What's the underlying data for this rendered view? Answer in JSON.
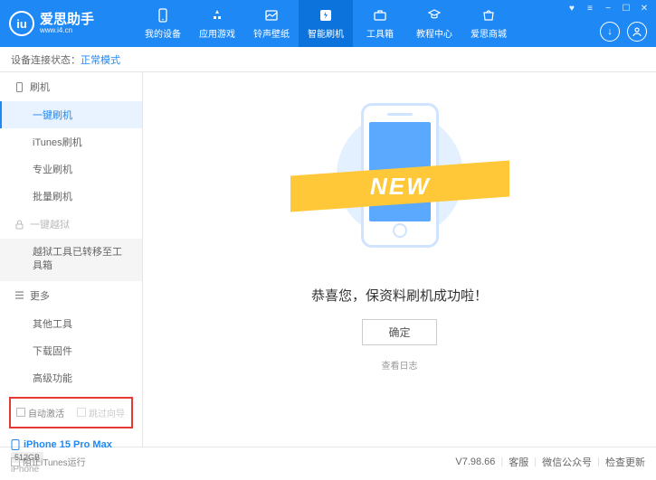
{
  "header": {
    "logo_letter": "iu",
    "app_name": "爱思助手",
    "app_url": "www.i4.cn",
    "nav": [
      {
        "label": "我的设备"
      },
      {
        "label": "应用游戏"
      },
      {
        "label": "铃声壁纸"
      },
      {
        "label": "智能刷机"
      },
      {
        "label": "工具箱"
      },
      {
        "label": "教程中心"
      },
      {
        "label": "爱思商城"
      }
    ]
  },
  "status": {
    "label": "设备连接状态：",
    "value": "正常模式"
  },
  "sidebar": {
    "flash_section": "刷机",
    "items_flash": [
      "一键刷机",
      "iTunes刷机",
      "专业刷机",
      "批量刷机"
    ],
    "jailbreak_section": "一键越狱",
    "jailbreak_note": "越狱工具已转移至工具箱",
    "more_section": "更多",
    "items_more": [
      "其他工具",
      "下载固件",
      "高级功能"
    ],
    "checkboxes": {
      "auto_activate": "自动激活",
      "skip_guide": "跳过向导"
    },
    "device": {
      "name": "iPhone 15 Pro Max",
      "storage": "512GB",
      "type": "iPhone"
    }
  },
  "main": {
    "ribbon": "NEW",
    "success": "恭喜您，保资料刷机成功啦！",
    "ok": "确定",
    "log": "查看日志"
  },
  "footer": {
    "block_itunes": "阻止iTunes运行",
    "version": "V7.98.66",
    "links": [
      "客服",
      "微信公众号",
      "检查更新"
    ]
  }
}
